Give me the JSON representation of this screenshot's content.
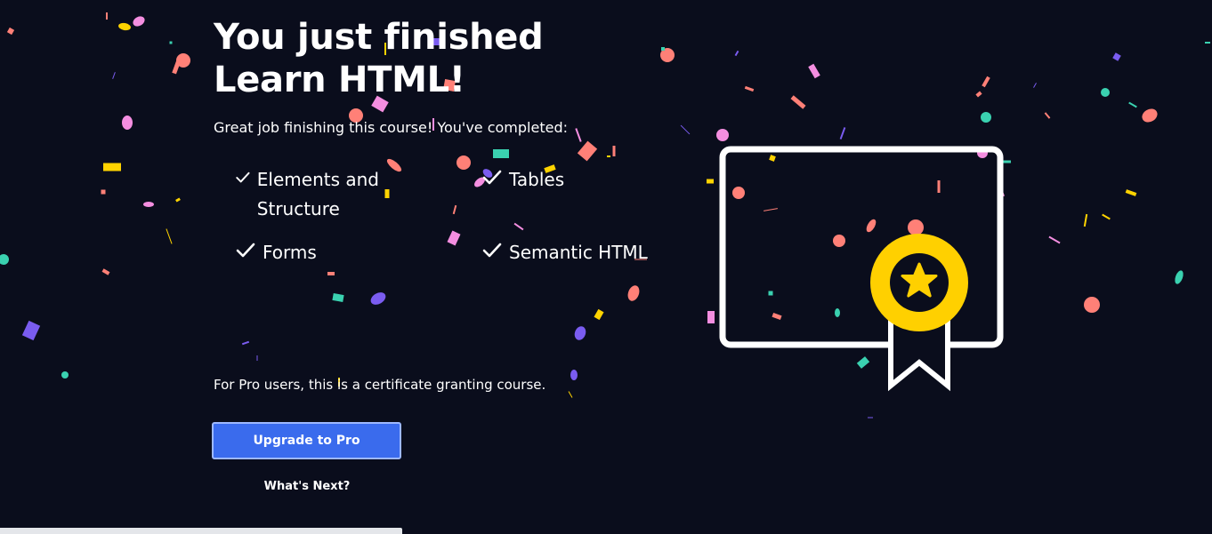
{
  "page": {
    "title_line1": "You just finished",
    "title_line2": "Learn HTML!",
    "intro": "Great job finishing this course! You've completed:",
    "lessons": [
      {
        "label": "Elements and Structure"
      },
      {
        "label": "Tables"
      },
      {
        "label": "Forms"
      },
      {
        "label": "Semantic HTML"
      }
    ],
    "pro_note": "For Pro users, this is a certificate granting course.",
    "upgrade_label": "Upgrade to Pro",
    "whats_next_label": "What's Next?"
  },
  "icons": {
    "check": "check-icon",
    "certificate": "certificate-icon",
    "badge_star": "star-icon"
  },
  "colors": {
    "background": "#0a0d1c",
    "button": "#3a6bed",
    "button_border": "#9db8ff",
    "badge": "#ffd000",
    "confetti": [
      "#f48ee0",
      "#ff8077",
      "#ffd300",
      "#3ad1b0",
      "#7a5cf0"
    ]
  }
}
